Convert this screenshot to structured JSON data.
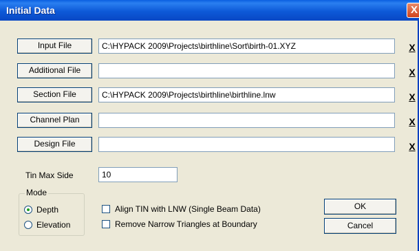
{
  "window": {
    "title": "Initial Data",
    "close_label": "X"
  },
  "files": [
    {
      "button": "Input File",
      "value": "C:\\HYPACK 2009\\Projects\\birthline\\Sort\\birth-01.XYZ",
      "clear": "X"
    },
    {
      "button": "Additional File",
      "value": "",
      "clear": "X"
    },
    {
      "button": "Section File",
      "value": "C:\\HYPACK 2009\\Projects\\birthline\\birthline.lnw",
      "clear": "X"
    },
    {
      "button": "Channel Plan",
      "value": "",
      "clear": "X"
    },
    {
      "button": "Design File",
      "value": "",
      "clear": "X"
    }
  ],
  "tin_max_side": {
    "label": "Tin Max Side",
    "value": "10"
  },
  "mode": {
    "title": "Mode",
    "options": [
      {
        "label": "Depth",
        "selected": true
      },
      {
        "label": "Elevation",
        "selected": false
      }
    ]
  },
  "options": [
    {
      "label": "Align TIN with LNW (Single Beam Data)",
      "checked": false
    },
    {
      "label": "Remove Narrow Triangles at Boundary",
      "checked": false
    }
  ],
  "buttons": {
    "ok": "OK",
    "cancel": "Cancel"
  }
}
